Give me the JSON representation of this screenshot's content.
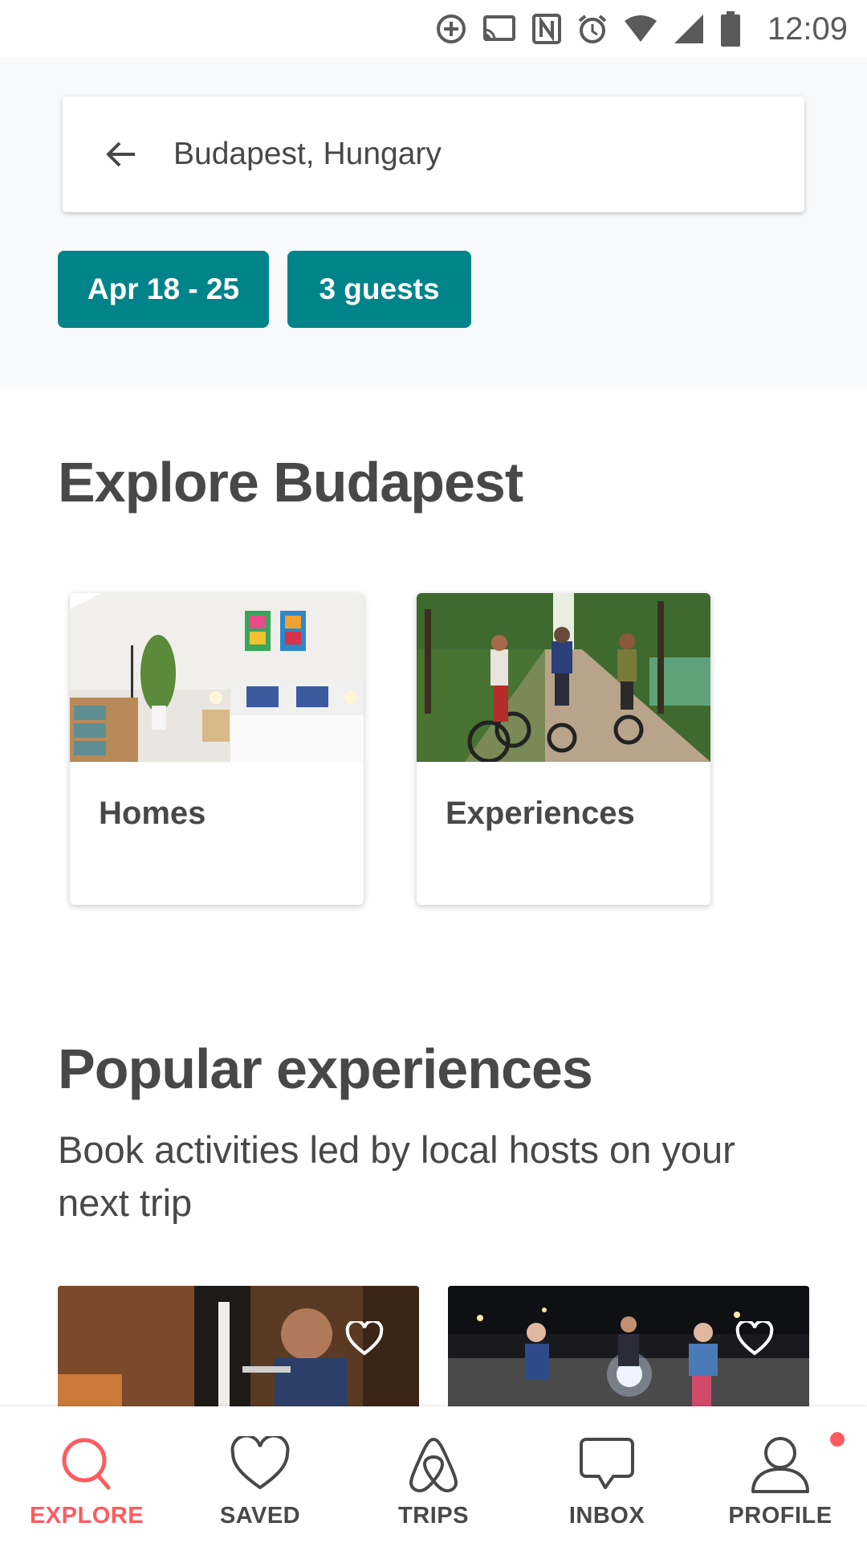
{
  "status_bar": {
    "time": "12:09",
    "icons": [
      "data-saver-icon",
      "cast-icon",
      "nfc-icon",
      "alarm-icon",
      "wifi-icon",
      "signal-icon",
      "battery-icon"
    ]
  },
  "search": {
    "location": "Budapest, Hungary",
    "dates": "Apr 18 - 25",
    "guests": "3 guests"
  },
  "explore": {
    "title": "Explore Budapest",
    "categories": [
      {
        "label": "Homes"
      },
      {
        "label": "Experiences"
      }
    ]
  },
  "popular": {
    "title": "Popular experiences",
    "subtitle": "Book activities led by local hosts on your next trip"
  },
  "tabs": [
    {
      "label": "EXPLORE",
      "icon": "search-icon",
      "active": true
    },
    {
      "label": "SAVED",
      "icon": "heart-icon",
      "active": false
    },
    {
      "label": "TRIPS",
      "icon": "airbnb-logo-icon",
      "active": false
    },
    {
      "label": "INBOX",
      "icon": "chat-bubble-icon",
      "active": false
    },
    {
      "label": "PROFILE",
      "icon": "person-icon",
      "active": false,
      "notification": true
    }
  ],
  "colors": {
    "accent": "#008489",
    "brand": "#FF5A5F",
    "text": "#484848"
  }
}
